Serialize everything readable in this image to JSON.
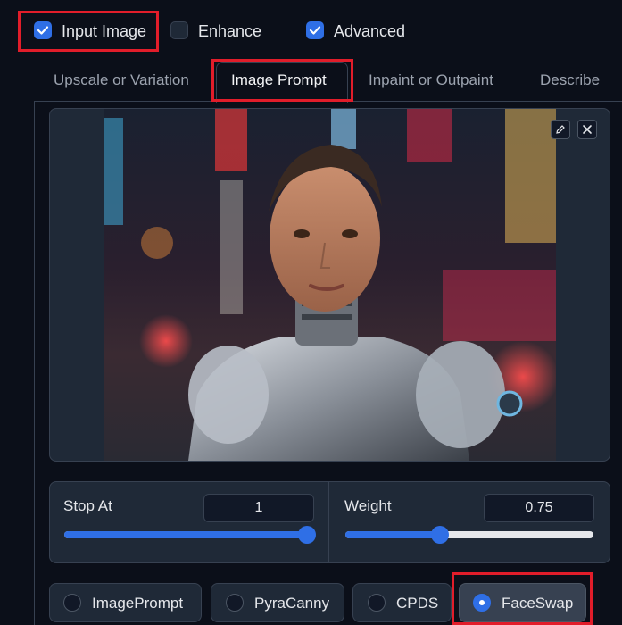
{
  "options": {
    "input_image": {
      "label": "Input Image",
      "checked": true
    },
    "enhance": {
      "label": "Enhance",
      "checked": false
    },
    "advanced": {
      "label": "Advanced",
      "checked": true
    }
  },
  "tabs": [
    {
      "label": "Upscale or Variation",
      "active": false
    },
    {
      "label": "Image Prompt",
      "active": true
    },
    {
      "label": "Inpaint or Outpaint",
      "active": false
    },
    {
      "label": "Describe",
      "active": false
    }
  ],
  "image": {
    "description_icon": "portrait-image",
    "edit_icon": "pencil-icon",
    "close_icon": "close-icon"
  },
  "controls": {
    "stop_at": {
      "label": "Stop At",
      "value": "1",
      "fraction": 1.0
    },
    "weight": {
      "label": "Weight",
      "value": "0.75",
      "fraction": 0.38
    }
  },
  "ip_types": [
    {
      "label": "ImagePrompt",
      "selected": false
    },
    {
      "label": "PyraCanny",
      "selected": false
    },
    {
      "label": "CPDS",
      "selected": false
    },
    {
      "label": "FaceSwap",
      "selected": true
    }
  ],
  "colors": {
    "accent": "#2f6fe6",
    "highlight": "#e11d2a",
    "background": "#0b0f19"
  }
}
